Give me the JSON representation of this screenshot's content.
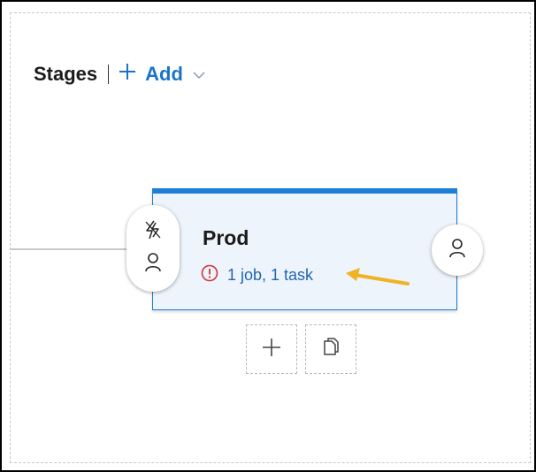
{
  "header": {
    "title": "Stages",
    "add_label": "Add"
  },
  "stage": {
    "name": "Prod",
    "status": "1 job, 1 task"
  },
  "icons": {
    "add": "plus-icon",
    "dropdown": "chevron-down-icon",
    "trigger": "lightning-icon",
    "pre_approver": "person-icon",
    "post_approver": "person-icon",
    "error": "error-circle-icon",
    "annotation_arrow": "arrow-icon",
    "add_stage": "plus-icon",
    "clone_stage": "copy-icon"
  },
  "colors": {
    "accent": "#1e7fd6",
    "link": "#2266b0",
    "error": "#d13438",
    "annotation": "#f0b323",
    "card_bg": "#eef4fb"
  }
}
